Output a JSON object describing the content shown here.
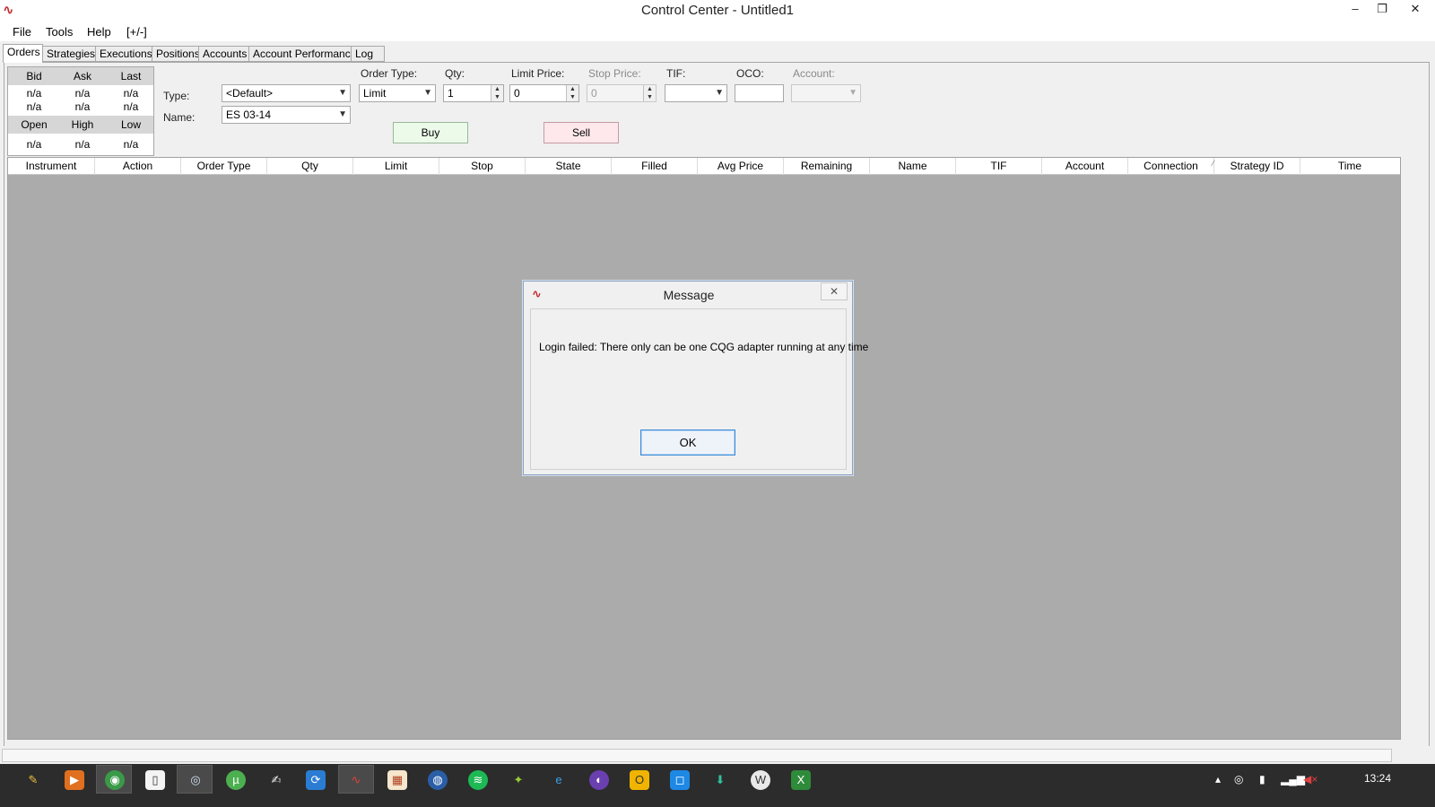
{
  "window": {
    "title": "Control Center - Untitled1",
    "minimize": "–",
    "maximize": "❐",
    "close": "✕",
    "app_icon": "∿"
  },
  "menu": [
    "File",
    "Tools",
    "Help",
    "[+/-]"
  ],
  "tabs": [
    "Orders",
    "Strategies",
    "Executions",
    "Positions",
    "Accounts",
    "Account Performance",
    "Log"
  ],
  "quote": {
    "headers1": [
      "Bid",
      "Ask",
      "Last"
    ],
    "row1": [
      "n/a",
      "n/a",
      "n/a"
    ],
    "row2": [
      "n/a",
      "n/a",
      "n/a"
    ],
    "headers2": [
      "Open",
      "High",
      "Low"
    ],
    "row3": [
      "n/a",
      "n/a",
      "n/a"
    ]
  },
  "entry": {
    "type_label": "Type:",
    "type_value": "<Default>",
    "name_label": "Name:",
    "name_value": "ES 03-14",
    "order_type_label": "Order Type:",
    "order_type_value": "Limit",
    "qty_label": "Qty:",
    "qty_value": "1",
    "limit_label": "Limit Price:",
    "limit_value": "0",
    "stop_label": "Stop Price:",
    "stop_value": "0",
    "tif_label": "TIF:",
    "tif_value": "",
    "oco_label": "OCO:",
    "oco_value": "",
    "account_label": "Account:",
    "account_value": "",
    "buy_label": "Buy",
    "sell_label": "Sell"
  },
  "grid": {
    "columns": [
      "Instrument",
      "Action",
      "Order Type",
      "Qty",
      "Limit",
      "Stop",
      "State",
      "Filled",
      "Avg Price",
      "Remaining",
      "Name",
      "TIF",
      "Account",
      "Connection",
      "Strategy ID",
      "Time"
    ]
  },
  "dialog": {
    "title": "Message",
    "close": "✕",
    "message": "Login failed: There only can be one CQG adapter running at any time",
    "ok_label": "OK"
  },
  "taskbar": {
    "clock": "13:24"
  },
  "colors": {
    "buy_bg": "#ecfbe9",
    "sell_bg": "#ffe8ec",
    "grid_bg": "#ababab",
    "taskbar_bg": "#2c2c2c",
    "brand_red": "#c0282d"
  }
}
